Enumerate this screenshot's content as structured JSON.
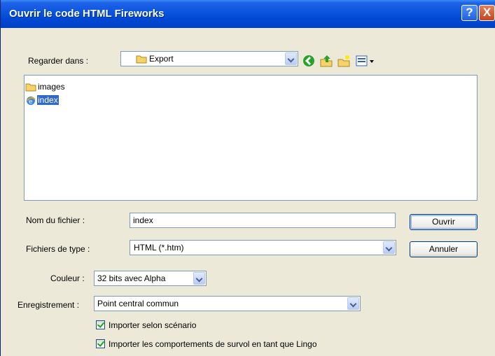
{
  "window": {
    "title": "Ouvrir le code HTML Fireworks",
    "help": "?",
    "close": "X"
  },
  "look_in": {
    "label": "Regarder dans :",
    "value": "Export"
  },
  "toolbar": {
    "icons": [
      "back-icon",
      "up-folder-icon",
      "new-folder-icon",
      "view-menu-icon"
    ]
  },
  "files": [
    {
      "name": "images",
      "icon": "folder-icon",
      "selected": false
    },
    {
      "name": "index",
      "icon": "html-file-icon",
      "selected": true
    }
  ],
  "filename": {
    "label": "Nom du fichier :",
    "value": "index"
  },
  "filetype": {
    "label": "Fichiers de type :",
    "value": "HTML (*.htm)"
  },
  "buttons": {
    "open": "Ouvrir",
    "cancel": "Annuler"
  },
  "color": {
    "label": "Couleur :",
    "value": "32 bits avec Alpha"
  },
  "record": {
    "label": "Enregistrement :",
    "value": "Point central commun"
  },
  "options": [
    {
      "label": "Importer selon scénario",
      "checked": true
    },
    {
      "label": "Importer les comportements de survol en tant que Lingo",
      "checked": true
    }
  ]
}
